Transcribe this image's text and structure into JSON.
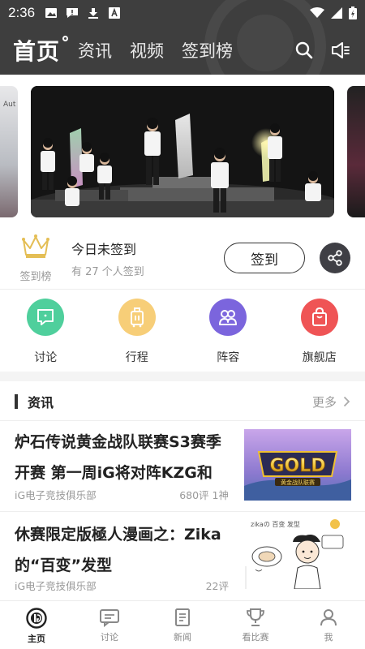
{
  "statusbar": {
    "time": "2:36"
  },
  "nav": {
    "home": "首页",
    "tabs": [
      "资讯",
      "视频",
      "签到榜"
    ]
  },
  "banner": {
    "side_left_text": "Aut"
  },
  "checkin": {
    "rank_label": "签到榜",
    "title": "今日未签到",
    "subtitle": "有 27 个人签到",
    "button": "签到"
  },
  "quick": [
    {
      "label": "讨论",
      "color": "#4fcf9c",
      "icon": "chat-icon"
    },
    {
      "label": "行程",
      "color": "#f7ce78",
      "icon": "luggage-icon"
    },
    {
      "label": "阵容",
      "color": "#7b65dd",
      "icon": "team-icon"
    },
    {
      "label": "旗舰店",
      "color": "#ef5455",
      "icon": "shopping-bag-icon"
    }
  ],
  "news": {
    "section_title": "资讯",
    "more": "更多",
    "articles": [
      {
        "title": "炉石传说黄金战队联赛S3赛季开赛 第一周iG将对阵KZG和",
        "source": "iG电子竞技俱乐部",
        "stats": "680评 1神",
        "thumb_text": "GOLD",
        "thumb_sub": "黄金战队联赛"
      },
      {
        "title": "休赛限定版極人漫画之：Zika的“百变”发型",
        "source": "iG电子竞技俱乐部",
        "stats": "22评",
        "thumb_text": "zikaの 百变 发型"
      }
    ]
  },
  "bottom_nav": [
    {
      "label": "主页",
      "icon": "ig-logo-icon",
      "active": true
    },
    {
      "label": "讨论",
      "icon": "discuss-icon",
      "active": false
    },
    {
      "label": "新闻",
      "icon": "news-icon",
      "active": false
    },
    {
      "label": "看比赛",
      "icon": "trophy-icon",
      "active": false
    },
    {
      "label": "我",
      "icon": "user-icon",
      "active": false
    }
  ]
}
